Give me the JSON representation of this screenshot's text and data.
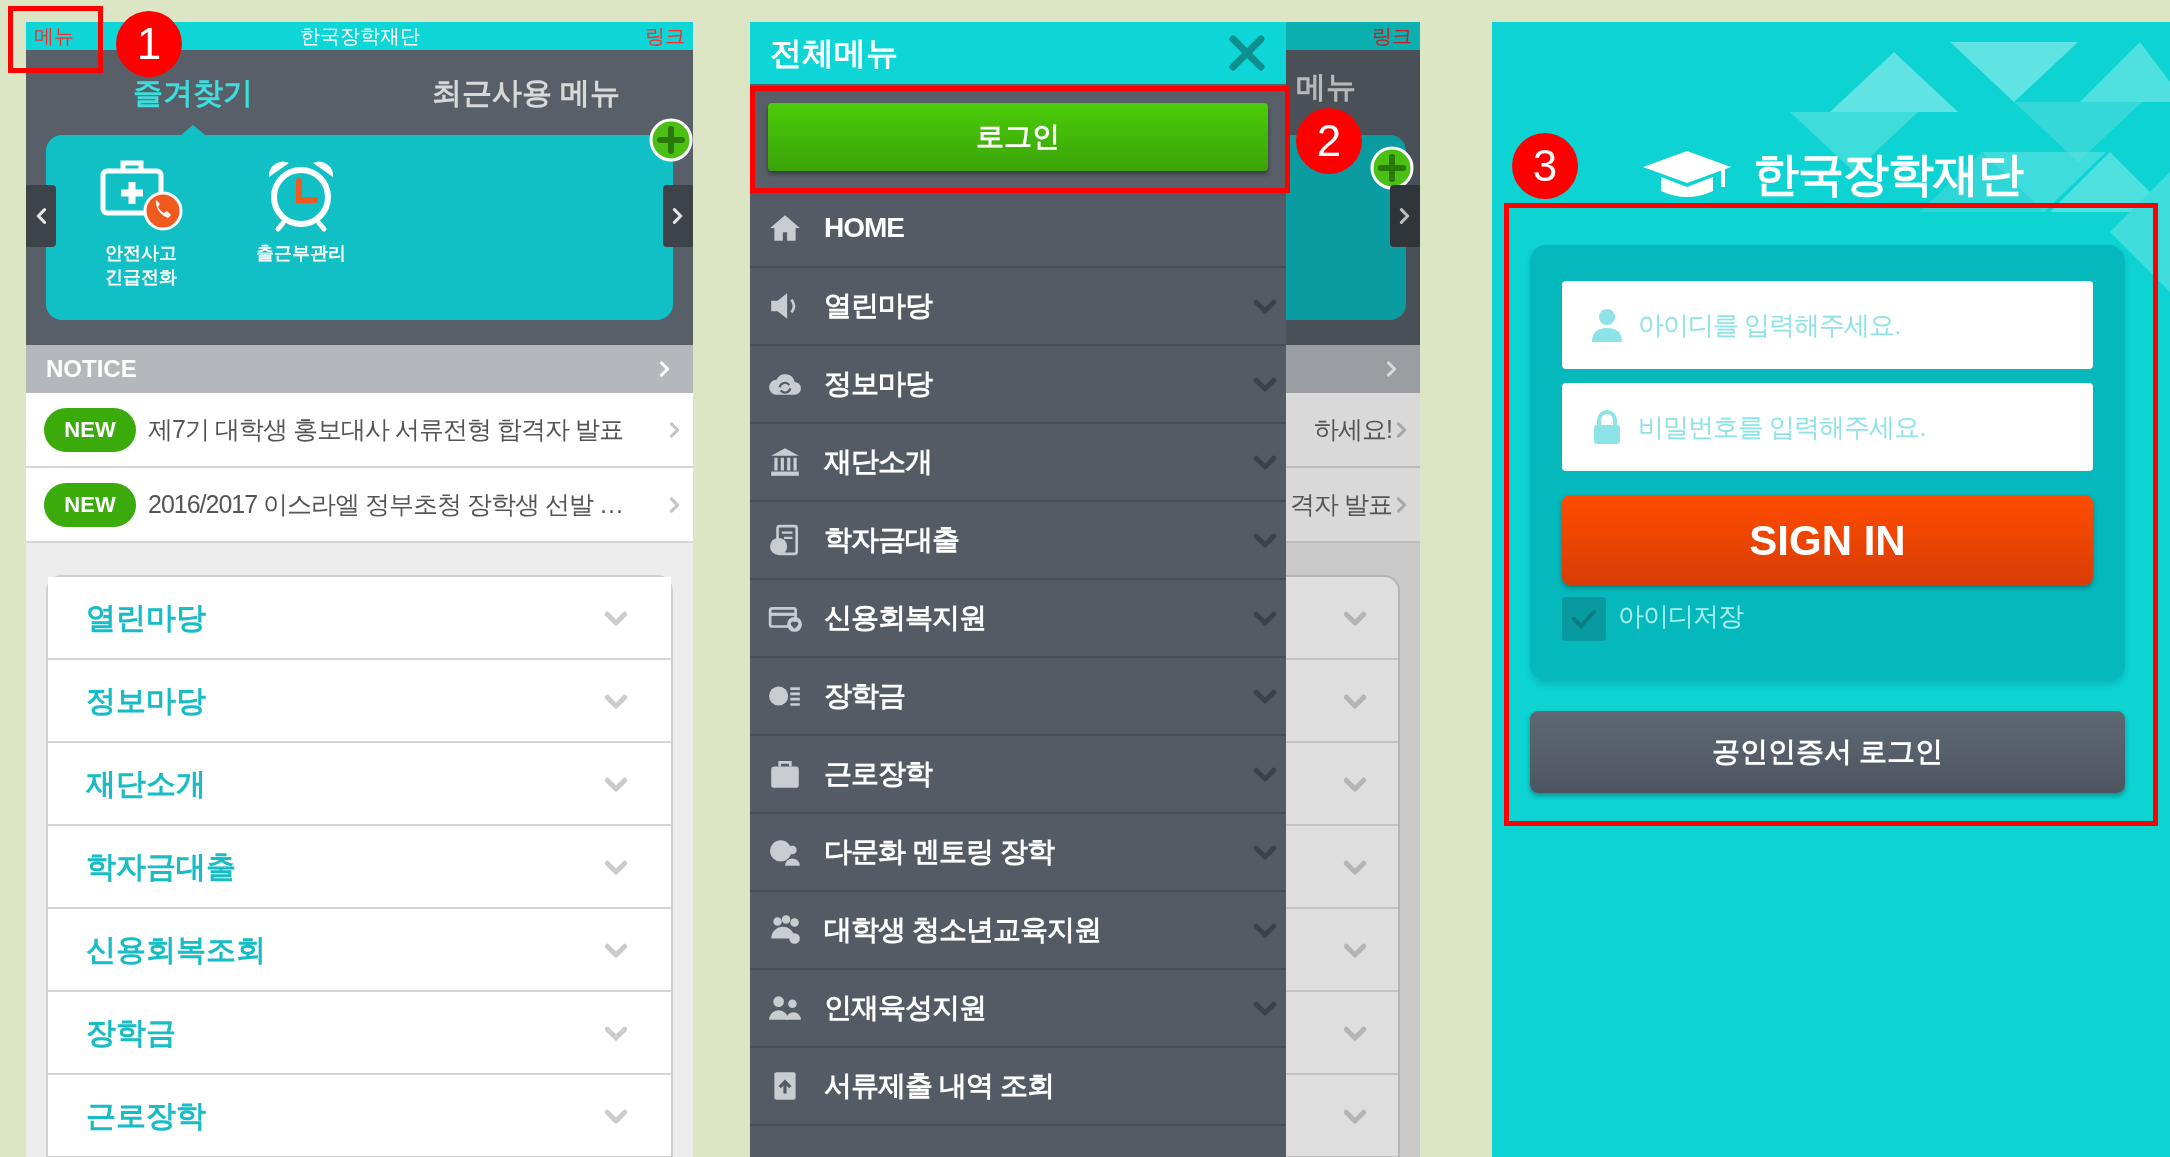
{
  "home_screen": {
    "header": {
      "menu_link": "메뉴",
      "title": "한국장학재단",
      "link": "링크"
    },
    "tabs": [
      {
        "label": "즐겨찾기",
        "selected": true
      },
      {
        "label": "최근사용 메뉴",
        "selected": false
      }
    ],
    "favorites": [
      {
        "kind": "first-aid-phone",
        "label": "안전사고 긴급전화"
      },
      {
        "kind": "alarm-clock",
        "label": "출근부관리"
      }
    ],
    "notice": {
      "title": "NOTICE",
      "items": [
        {
          "badge": "NEW",
          "text": "제7기 대학생 홍보대사 서류전형 합격자 발표"
        },
        {
          "badge": "NEW",
          "text": "2016/2017 이스라엘 정부초청 장학생 선발 …"
        }
      ]
    },
    "menu": [
      "열린마당",
      "정보마당",
      "재단소개",
      "학자금대출",
      "신용회복조회",
      "장학금",
      "근로장학"
    ]
  },
  "drawer_screen": {
    "title": "전체메뉴",
    "login_button": "로그인",
    "items": [
      {
        "kind": "home",
        "label": "HOME",
        "expandable": false
      },
      {
        "kind": "speaker",
        "label": "열린마당",
        "expandable": true
      },
      {
        "kind": "cloud",
        "label": "정보마당",
        "expandable": true
      },
      {
        "kind": "bank",
        "label": "재단소개",
        "expandable": true
      },
      {
        "kind": "won-document",
        "label": "학자금대출",
        "expandable": true
      },
      {
        "kind": "card-heart",
        "label": "신용회복지원",
        "expandable": true
      },
      {
        "kind": "won-list",
        "label": "장학금",
        "expandable": true
      },
      {
        "kind": "briefcase",
        "label": "근로장학",
        "expandable": true
      },
      {
        "kind": "globe-person",
        "label": "다문화 멘토링 장학",
        "expandable": true
      },
      {
        "kind": "group",
        "label": "대학생 청소년교육지원",
        "expandable": true
      },
      {
        "kind": "people",
        "label": "인재육성지원",
        "expandable": true
      },
      {
        "kind": "document-upload",
        "label": "서류제출 내역 조회",
        "expandable": false
      }
    ],
    "behind": {
      "link": "링크",
      "tab": "메뉴",
      "notices": [
        "하세요!",
        "격자 발표"
      ]
    }
  },
  "login_screen": {
    "logo_text": "한국장학재단",
    "id_field": {
      "placeholder": "아이디를 입력해주세요."
    },
    "password_field": {
      "placeholder": "비밀번호를 입력해주세요."
    },
    "sign_in_button": "SIGN IN",
    "remember_id": {
      "label": "아이디저장",
      "checked": true
    },
    "certificate_button": "공인인증서 로그인"
  },
  "annotations": [
    {
      "number": "1"
    },
    {
      "number": "2"
    },
    {
      "number": "3"
    }
  ]
}
